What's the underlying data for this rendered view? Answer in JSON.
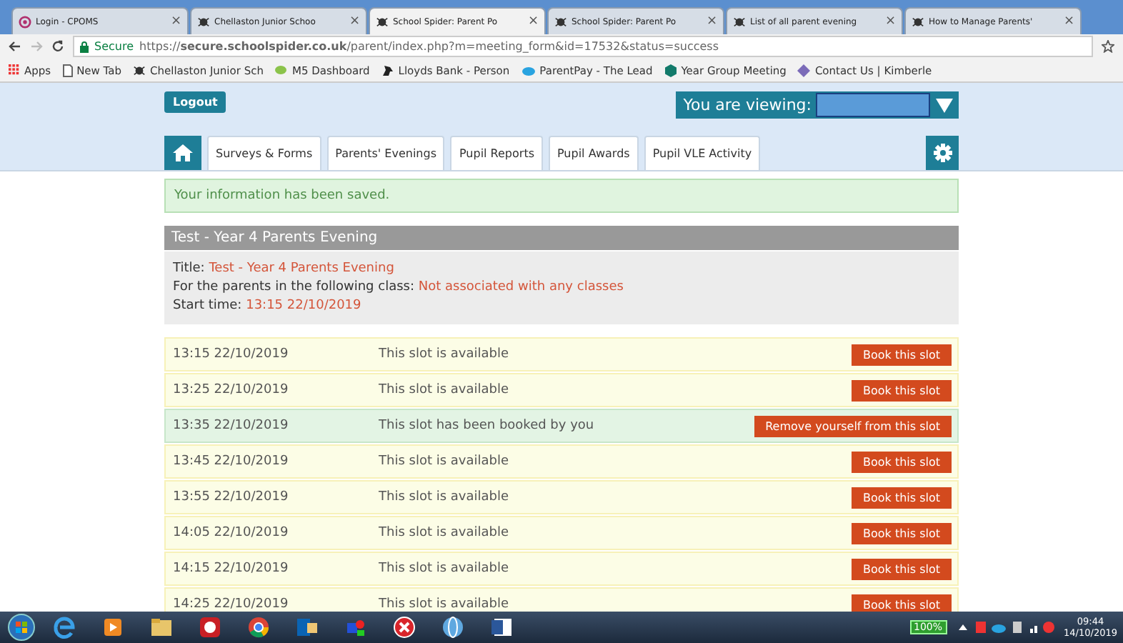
{
  "browser_tabs": [
    {
      "label": "Login - CPOMS",
      "selected": false
    },
    {
      "label": "Chellaston Junior Schoo",
      "selected": false
    },
    {
      "label": "School Spider: Parent Po",
      "selected": true
    },
    {
      "label": "School Spider: Parent Po",
      "selected": false
    },
    {
      "label": "List of all parent evening",
      "selected": false
    },
    {
      "label": "How to Manage Parents'",
      "selected": false
    }
  ],
  "tab_close": "×",
  "address_bar": {
    "secure_label": "Secure",
    "url": "https://**secure.schoolspider.co.uk**/parent/index.php?m=meeting_form&id=17532&status=success"
  },
  "bookmarks": [
    "Apps",
    "New Tab",
    "Chellaston Junior Sch",
    "M5 Dashboard",
    "Lloyds Bank - Person",
    "ParentPay - The Lead",
    "Year Group Meeting",
    "Contact Us | Kimberle"
  ],
  "header": {
    "logout": "Logout",
    "viewing_label": "You are viewing:"
  },
  "nav_tabs": [
    "Surveys & Forms",
    "Parents' Evenings",
    "Pupil Reports",
    "Pupil Awards",
    "Pupil VLE Activity"
  ],
  "alert": "Your information has been saved.",
  "meeting": {
    "heading": "Test - Year 4 Parents Evening",
    "details": [
      {
        "label": "Title:",
        "value": "Test - Year 4 Parents Evening"
      },
      {
        "label": "For the parents in the following class:",
        "value": "Not associated with any classes"
      },
      {
        "label": "Start time:",
        "value": "13:15 22/10/2019"
      }
    ]
  },
  "slots": [
    {
      "time": "13:15 22/10/2019",
      "status": "This slot is available",
      "action": "Book this slot",
      "booked": false
    },
    {
      "time": "13:25 22/10/2019",
      "status": "This slot is available",
      "action": "Book this slot",
      "booked": false
    },
    {
      "time": "13:35 22/10/2019",
      "status": "This slot has been booked by you",
      "action": "Remove yourself from this slot",
      "booked": true
    },
    {
      "time": "13:45 22/10/2019",
      "status": "This slot is available",
      "action": "Book this slot",
      "booked": false
    },
    {
      "time": "13:55 22/10/2019",
      "status": "This slot is available",
      "action": "Book this slot",
      "booked": false
    },
    {
      "time": "14:05 22/10/2019",
      "status": "This slot is available",
      "action": "Book this slot",
      "booked": false
    },
    {
      "time": "14:15 22/10/2019",
      "status": "This slot is available",
      "action": "Book this slot",
      "booked": false
    },
    {
      "time": "14:25 22/10/2019",
      "status": "This slot is available",
      "action": "Book this slot",
      "booked": false
    }
  ],
  "taskbar": {
    "battery": "100%",
    "time": "09:44",
    "date": "14/10/2019"
  }
}
